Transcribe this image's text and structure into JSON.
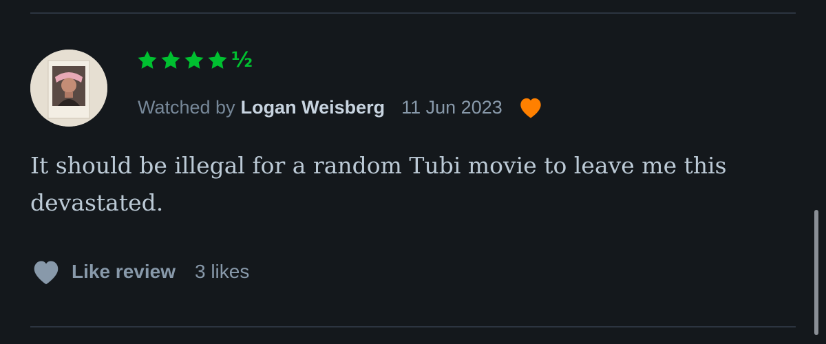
{
  "review": {
    "rating": {
      "stars": 4.5,
      "half_glyph": "½",
      "color": "#00c030"
    },
    "meta": {
      "prefix": "Watched by",
      "username": "Logan Weisberg",
      "date": "11 Jun 2023",
      "liked": true,
      "heart_color": "#ff8000"
    },
    "text": "It should be illegal for a random Tubi movie to leave me this devastated.",
    "actions": {
      "like_label": "Like review",
      "likes_count": "3 likes"
    }
  },
  "theme": {
    "background": "#14181c",
    "divider": "#2c3440",
    "muted_text": "#8899aa",
    "body_text": "#bccad6"
  },
  "icons": {
    "avatar": "avatar-photo",
    "rating": "star-icon",
    "liked": "heart-icon",
    "like_action": "heart-icon"
  }
}
